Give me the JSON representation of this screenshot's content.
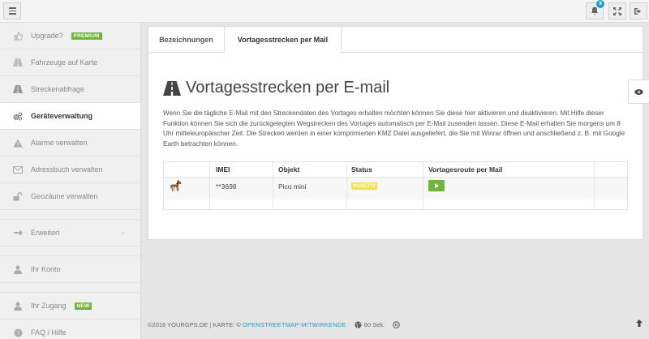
{
  "topbar": {
    "notifications_count": "9"
  },
  "sidebar": {
    "items": [
      {
        "label": "Upgrade?",
        "tag": "PREMIUM",
        "icon": "thumbs-up-icon"
      },
      {
        "label": "Fahrzeuge auf Karte",
        "icon": "road-icon"
      },
      {
        "label": "Streckenabfrage",
        "icon": "road-icon"
      },
      {
        "label": "Geräteverwaltung",
        "icon": "gears-icon",
        "active": true
      },
      {
        "label": "Alarme verwalten",
        "icon": "warning-icon"
      },
      {
        "label": "Adressbuch verwalten",
        "icon": "envelope-icon"
      },
      {
        "label": "Geozäune verwalten",
        "icon": "unlock-icon"
      },
      {
        "label": "Erweitert",
        "icon": "arrow-right-icon"
      },
      {
        "label": "Ihr Konto",
        "icon": "user-icon"
      },
      {
        "label": "Ihr Zugang",
        "tag": "NEW",
        "icon": "user-icon"
      },
      {
        "label": "FAQ / Hilfe",
        "icon": "question-icon"
      }
    ]
  },
  "tabs": [
    {
      "label": "Bezeichnungen"
    },
    {
      "label": "Vortagesstrecken per Mail",
      "active": true
    }
  ],
  "main": {
    "title": "Vortagesstrecken per E-mail",
    "description": "Wenn Sie die tägliche E-Mail mit den Streckendaten des Vortages erhalten möchten können Sie diese hier aktivieren und deaktivieren. Mit Hilfe dieser Funktion können Sie sich die zurückgelegten Wegstrecken des Vortages automatisch per E-Mail zusenden lassen. Diese E-Mail erhalten Sie morgens um 8 Uhr mitteleuropäischer Zeit. Die Strecken werden in einer komprimierten KMZ Datei ausgeliefert, die Sie mit Winrar öffnen und anschließend z. B. mit Google Earth betrachten können."
  },
  "table": {
    "headers": [
      "",
      "IMEI",
      "Objekt",
      "Status",
      "Vortagesroute per Mail"
    ],
    "rows": [
      {
        "icon": "horse-icon",
        "imei": "**3698",
        "objekt": "Pico mini",
        "status": "INAKTIV"
      }
    ]
  },
  "footer": {
    "copyright": "©2016 YOURGPS.DE | KARTE: ©",
    "link": "OPENSTREETMAP-MITWIRKENDE",
    "refresh": "60 Sek."
  },
  "colors": {
    "accent": "#1e9ec6",
    "success": "#71b43c",
    "warning": "#f5e24a"
  }
}
